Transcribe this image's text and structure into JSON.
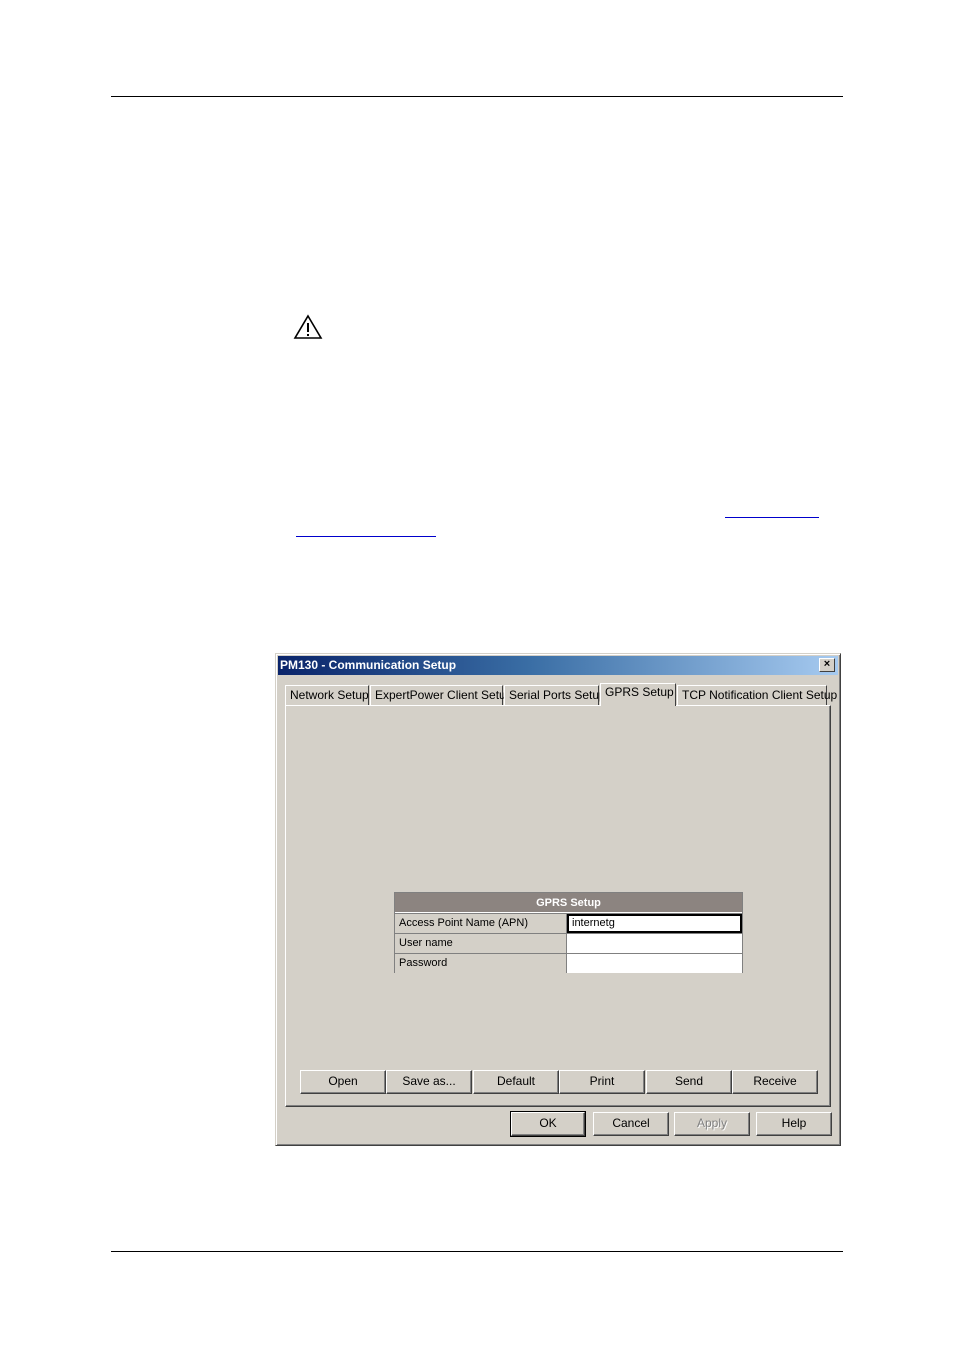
{
  "dialog": {
    "title": "PM130 - Communication Setup",
    "close_glyph": "×",
    "tabs": [
      "Network Setup",
      "ExpertPower Client Setup",
      "Serial Ports Setup",
      "GPRS Setup",
      "TCP Notification Client Setup"
    ],
    "active_tab": "GPRS Setup",
    "grid": {
      "header": "GPRS Setup",
      "rows": [
        {
          "label": "Access Point Name (APN)",
          "value": "internetg"
        },
        {
          "label": "User name",
          "value": ""
        },
        {
          "label": "Password",
          "value": ""
        }
      ]
    },
    "panel_buttons": [
      "Open",
      "Save as...",
      "Default",
      "Print",
      "Send",
      "Receive"
    ],
    "dialog_buttons": [
      "OK",
      "Cancel",
      "Apply",
      "Help"
    ]
  },
  "icons": {
    "warning": "warning-icon",
    "close": "close-icon"
  },
  "colors": {
    "title_bar_start": "#0a246a",
    "title_bar_end": "#a6caf0",
    "dialog_face": "#d4d0c8",
    "grid_header": "#8c8480"
  }
}
